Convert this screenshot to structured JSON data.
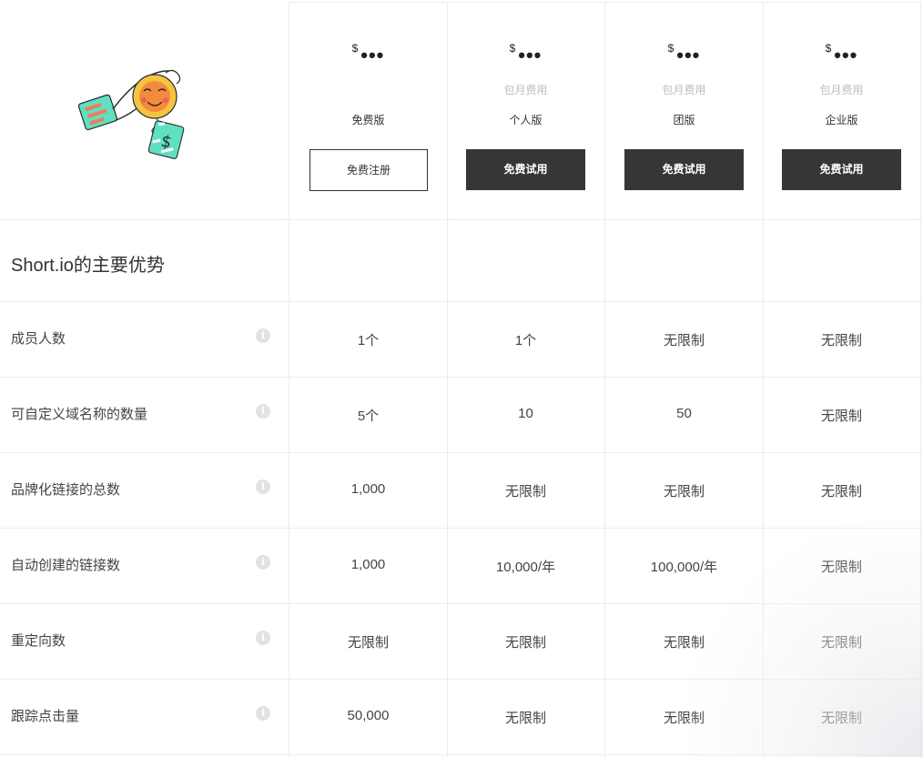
{
  "plans": [
    {
      "currency": "$",
      "price": "•••",
      "period": "",
      "name": "免费版",
      "button": "免费注册",
      "style": "outline"
    },
    {
      "currency": "$",
      "price": "•••",
      "period": "包月费用",
      "name": "个人版",
      "button": "免费试用",
      "style": "dark"
    },
    {
      "currency": "$",
      "price": "•••",
      "period": "包月费用",
      "name": "团版",
      "button": "免费试用",
      "style": "dark"
    },
    {
      "currency": "$",
      "price": "•••",
      "period": "包月费用",
      "name": "企业版",
      "button": "免费试用",
      "style": "dark"
    }
  ],
  "section_title": "Short.io的主要优势",
  "features": [
    {
      "label": "成员人数",
      "values": [
        "1个",
        "1个",
        "无限制",
        "无限制"
      ]
    },
    {
      "label": "可自定义域名称的数量",
      "values": [
        "5个",
        "10",
        "50",
        "无限制"
      ]
    },
    {
      "label": "品牌化链接的总数",
      "values": [
        "1,000",
        "无限制",
        "无限制",
        "无限制"
      ]
    },
    {
      "label": "自动创建的链接数",
      "values": [
        "1,000",
        "10,000/年",
        "100,000/年",
        "无限制"
      ]
    },
    {
      "label": "重定向数",
      "values": [
        "无限制",
        "无限制",
        "无限制",
        "无限制"
      ]
    },
    {
      "label": "跟踪点击量",
      "values": [
        "50,000",
        "无限制",
        "无限制",
        "无限制"
      ]
    }
  ],
  "info_icon": "i",
  "illustration": "hand-holding-money-bag-icon",
  "colors": {
    "dark_button": "#363636",
    "grid_line": "#ececec",
    "muted_text": "#bdbdbd"
  }
}
